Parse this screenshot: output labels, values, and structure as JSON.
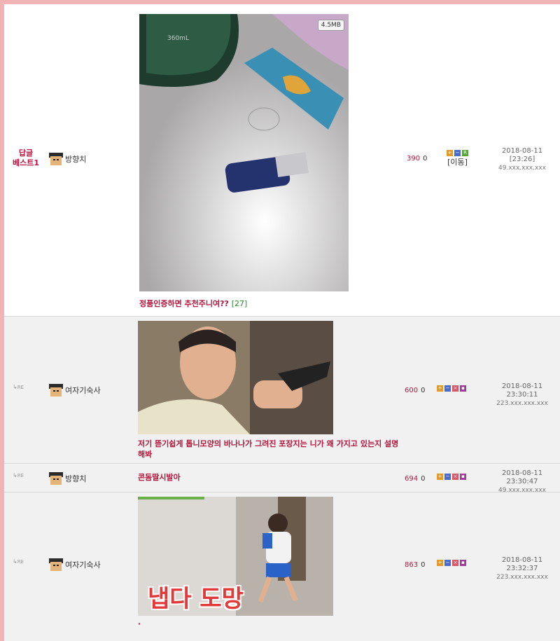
{
  "posts": [
    {
      "label": "답글\n베스트1",
      "author": "방향치",
      "file_size": "4.5MB",
      "title": "정품인증하면 추천주니여??",
      "comment_count": "[27]",
      "score": "390",
      "zero": "0",
      "move": "[이동]",
      "date": "2018-08-11",
      "time": "[23:26]",
      "ip": "49.xxx.xxx.xxx",
      "image_text": "360mL"
    },
    {
      "re": "RE",
      "author": "여자기숙사",
      "title": "저기 뜯기쉽게 톱니모양의 바나나가 그려진 포장지는 니가 왜 가지고 있는지 설명해봐",
      "score": "600",
      "zero": "0",
      "datetime": "2018-08-11 23:30:11",
      "ip": "223.xxx.xxx.xxx"
    },
    {
      "re": "RE",
      "author": "방향치",
      "title": "콘돔딸시발아",
      "score": "694",
      "zero": "0",
      "datetime": "2018-08-11 23:30:47",
      "ip": "49.xxx.xxx.xxx"
    },
    {
      "re": "RE",
      "author": "여자기숙사",
      "title": "·",
      "score": "863",
      "zero": "0",
      "datetime": "2018-08-11 23:32:37",
      "ip": "223.xxx.xxx.xxx",
      "image_caption": "냅다 도망"
    }
  ],
  "colors": {
    "accent": "#b5153c",
    "border": "#f0b4b4",
    "row_bg": "#f1f1f1"
  },
  "icons": [
    "plus-icon",
    "minus-icon",
    "reply-icon",
    "close-icon",
    "delete-icon"
  ]
}
